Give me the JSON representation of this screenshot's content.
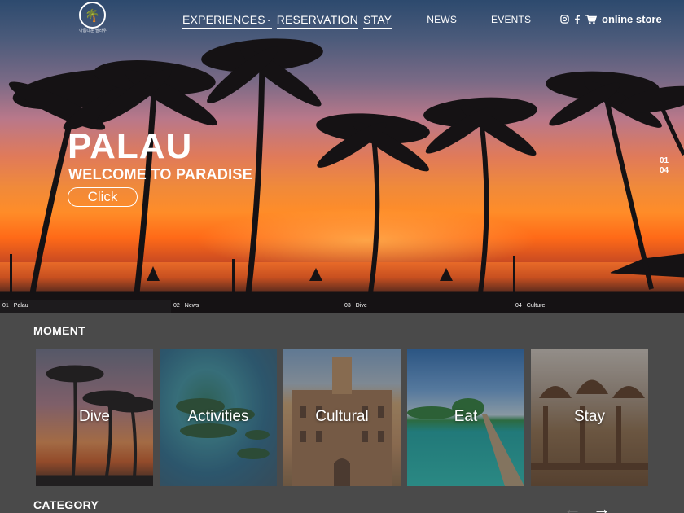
{
  "header": {
    "logo_caption": "아름다운 팔라우",
    "nav": {
      "experiences": "EXPERIENCES",
      "reservation": "RESERVATION",
      "stay": "STAY",
      "news": "NEWS",
      "events": "EVENTS"
    },
    "store_label": "online store",
    "icons": [
      "instagram-icon",
      "facebook-icon",
      "cart-icon"
    ]
  },
  "hero": {
    "title": "PALAU",
    "subtitle": "WELCOME TO PARADISE",
    "button_label": "Click",
    "pager_current": "01",
    "pager_total": "04",
    "tabs": [
      {
        "num": "01",
        "label": "Palau"
      },
      {
        "num": "02",
        "label": "News"
      },
      {
        "num": "03",
        "label": "Dive"
      },
      {
        "num": "04",
        "label": "Culture"
      }
    ],
    "active_tab": 0
  },
  "moment": {
    "title": "MOMENT",
    "cards": [
      {
        "label": "Dive"
      },
      {
        "label": "Activities"
      },
      {
        "label": "Cultural"
      },
      {
        "label": "Eat"
      },
      {
        "label": "Stay"
      }
    ]
  },
  "category": {
    "title": "CATEGORY"
  },
  "colors": {
    "page_background": "#4a4a4a",
    "text": "#ffffff"
  }
}
